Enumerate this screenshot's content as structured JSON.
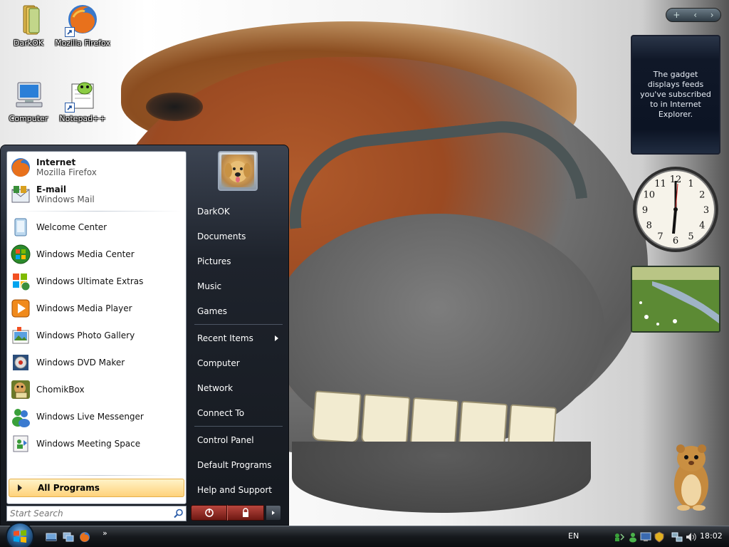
{
  "desktop": {
    "icons": [
      {
        "label": "DarkOK",
        "icon": "folder-icon"
      },
      {
        "label": "Mozilla Firefox",
        "icon": "firefox-icon"
      },
      {
        "label": "Computer",
        "icon": "computer-icon"
      },
      {
        "label": "Notepad++",
        "icon": "notepad-plus-plus-icon"
      }
    ]
  },
  "gadgets": {
    "feed_message": "The gadget displays feeds you've subscribed to in Internet Explorer.",
    "clock_numbers": [
      "12",
      "1",
      "2",
      "3",
      "4",
      "5",
      "6",
      "7",
      "8",
      "9",
      "10",
      "11"
    ]
  },
  "start_menu": {
    "pinned": [
      {
        "label": "Internet",
        "sub": "Mozilla Firefox",
        "icon": "firefox-icon"
      },
      {
        "label": "E-mail",
        "sub": "Windows Mail",
        "icon": "mail-icon"
      }
    ],
    "recent": [
      {
        "label": "Welcome Center",
        "icon": "welcome-center-icon"
      },
      {
        "label": "Windows Media Center",
        "icon": "media-center-icon"
      },
      {
        "label": "Windows Ultimate Extras",
        "icon": "ultimate-extras-icon"
      },
      {
        "label": "Windows Media Player",
        "icon": "media-player-icon"
      },
      {
        "label": "Windows Photo Gallery",
        "icon": "photo-gallery-icon"
      },
      {
        "label": "Windows DVD Maker",
        "icon": "dvd-maker-icon"
      },
      {
        "label": "ChomikBox",
        "icon": "chomikbox-icon"
      },
      {
        "label": "Windows Live Messenger",
        "icon": "messenger-icon"
      },
      {
        "label": "Windows Meeting Space",
        "icon": "meeting-space-icon"
      }
    ],
    "all_programs": "All Programs",
    "search_placeholder": "Start Search",
    "right": [
      {
        "label": "DarkOK"
      },
      {
        "label": "Documents"
      },
      {
        "label": "Pictures"
      },
      {
        "label": "Music"
      },
      {
        "label": "Games"
      },
      {
        "label": "Recent Items",
        "has_submenu": true
      },
      {
        "label": "Computer"
      },
      {
        "label": "Network"
      },
      {
        "label": "Connect To"
      },
      {
        "label": "Control Panel"
      },
      {
        "label": "Default Programs"
      },
      {
        "label": "Help and Support"
      }
    ]
  },
  "taskbar": {
    "language": "EN",
    "time": "18:02",
    "quick_launch": [
      "show-desktop-icon",
      "switch-windows-icon",
      "firefox-icon"
    ],
    "tray_icons": [
      "network-sharing-icon",
      "messenger-icon",
      "display-icon",
      "security-icon",
      "network-icon",
      "volume-icon"
    ]
  },
  "colors": {
    "menu_dark": "#1e232c",
    "all_programs_highlight": "#ffd27a",
    "power_red": "#b9463e"
  }
}
